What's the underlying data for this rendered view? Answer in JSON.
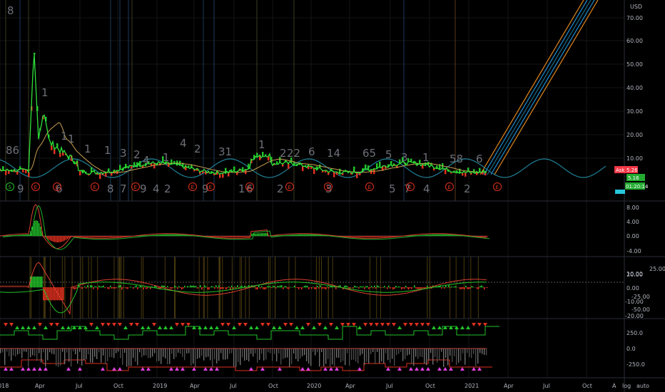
{
  "toolbar": {
    "currency": "USD"
  },
  "colors": {
    "background": "#000000",
    "up": "#22c22a",
    "down": "#e0301e",
    "cycle": "#1f7f95",
    "channel_orange": "#e58a1f",
    "channel_blue": "#1f8fd6",
    "earnings": "#e0301e",
    "ask_badge": "#f23645",
    "last_badge": "#22ab30"
  },
  "price_badges": {
    "ask_label": "Ask",
    "ask_value": "5.26",
    "last_value": "5.16",
    "countdown": "01:20:14"
  },
  "icons": {
    "settings": "A",
    "log": "log",
    "auto": "auto"
  },
  "earnings_marker_label": "E",
  "split_marker_label": "S",
  "panes": [
    {
      "id": "price",
      "y_ticks": [
        "70.00",
        "60.00",
        "50.00",
        "40.00",
        "30.00",
        "20.00",
        "10.00"
      ]
    },
    {
      "id": "macd",
      "y_ticks": [
        "8.00",
        "4.00",
        "0.00",
        "-4.00"
      ]
    },
    {
      "id": "oscillator",
      "y_ticks": [
        "25.00",
        "20.00",
        "10.00",
        "0.00",
        "-10.00",
        "-20.00",
        "-25.00",
        "-50.00"
      ]
    },
    {
      "id": "signals",
      "y_ticks": [
        "250.0",
        "0.0",
        "-250.0"
      ]
    }
  ],
  "x_axis": [
    "2018",
    "Apr",
    "Jul",
    "Oct",
    "2019",
    "Apr",
    "Jul",
    "Oct",
    "2020",
    "Apr",
    "Jul",
    "Oct",
    "2021",
    "Apr",
    "Jul",
    "Oct"
  ],
  "count_labels_top": [
    "8",
    "1",
    "1",
    "1",
    "1",
    "3",
    "2",
    "1",
    "4",
    "2",
    "31",
    "1",
    "2",
    "22",
    "6",
    "14",
    "65",
    "5",
    "3",
    "1",
    "58",
    "6",
    "86",
    "1",
    "4"
  ],
  "count_labels_bottom": [
    "9",
    "6",
    "8",
    "7",
    "9",
    "4",
    "2",
    "9",
    "1",
    "6",
    "2",
    "3",
    "5",
    "7",
    "4",
    "2"
  ]
}
